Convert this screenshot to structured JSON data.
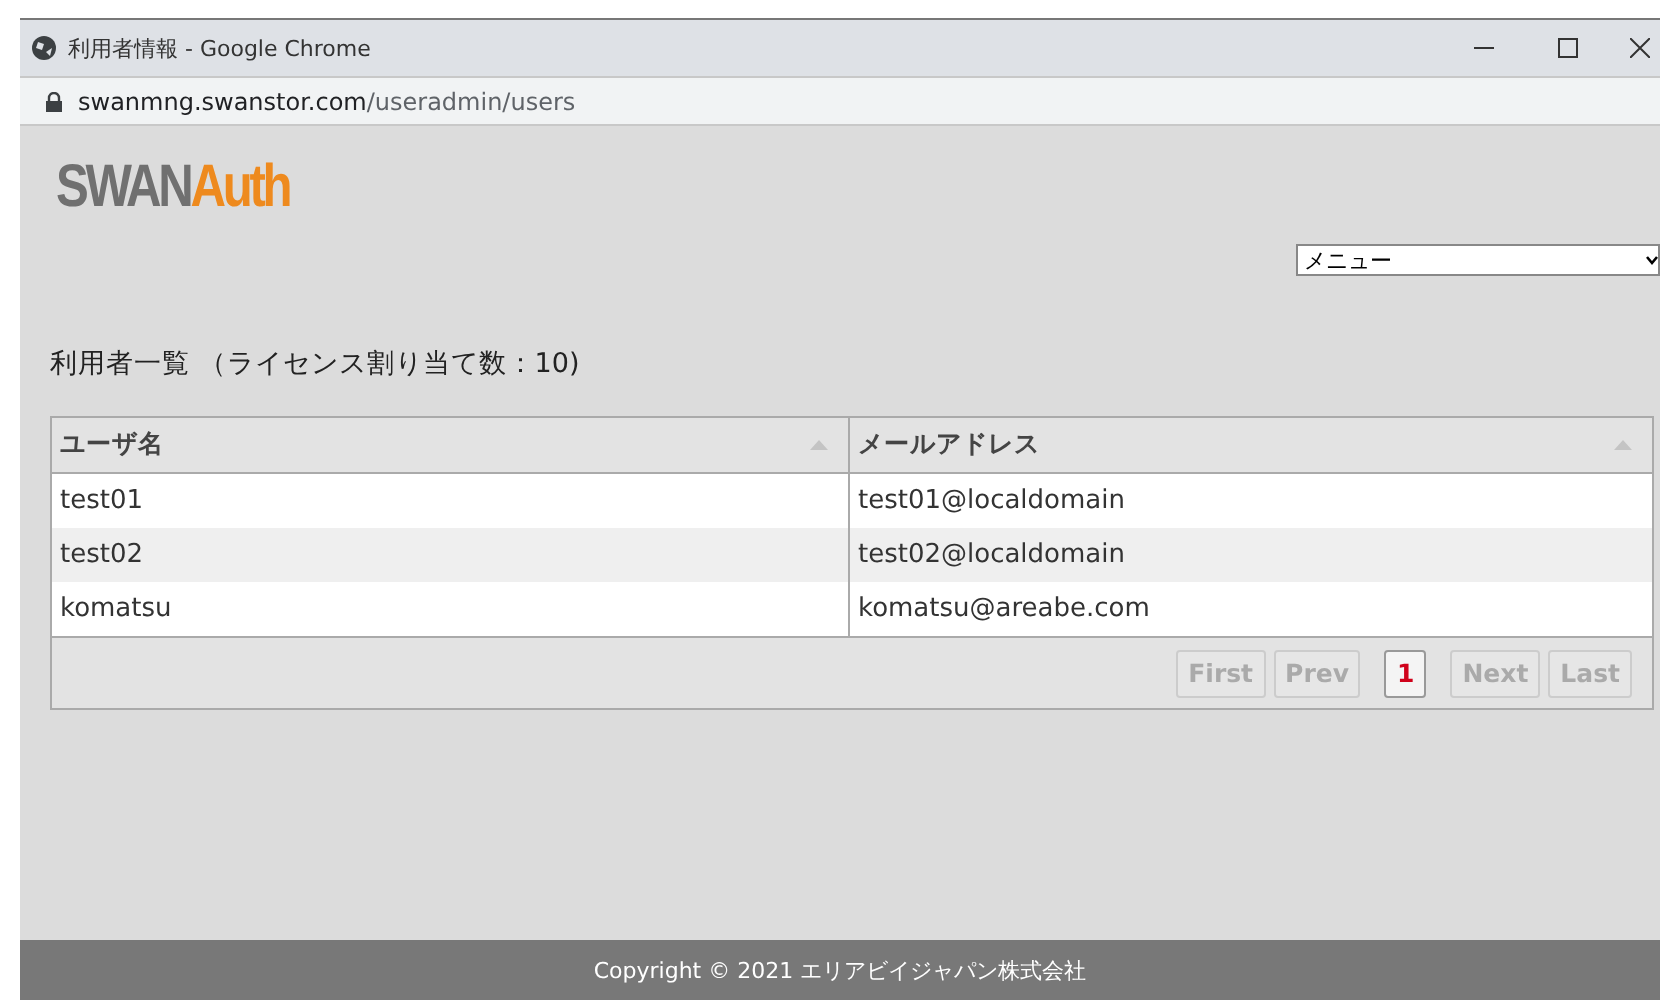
{
  "window": {
    "title": "利用者情報 - Google Chrome"
  },
  "address_bar": {
    "host": "swanmng.swanstor.com",
    "path": "/useradmin/users"
  },
  "logo": {
    "part_1": "SWAN",
    "part_2": "Auth"
  },
  "menu_select": {
    "value": "メニュー"
  },
  "heading": "利用者一覧 （ライセンス割り当て数：10)",
  "table": {
    "columns": [
      "ユーザ名",
      "メールアドレス"
    ],
    "rows": [
      [
        "test01",
        "test01@localdomain"
      ],
      [
        "test02",
        "test02@localdomain"
      ],
      [
        "komatsu",
        "komatsu@areabe.com"
      ]
    ]
  },
  "pager": [
    {
      "label": "First",
      "kind": "nav",
      "disabled": true,
      "selected": false
    },
    {
      "label": "Prev",
      "kind": "nav",
      "disabled": true,
      "selected": false
    },
    {
      "label": "1",
      "kind": "page",
      "disabled": false,
      "selected": true
    },
    {
      "label": "Next",
      "kind": "nav",
      "disabled": true,
      "selected": false
    },
    {
      "label": "Last",
      "kind": "nav",
      "disabled": true,
      "selected": false
    }
  ],
  "footer": "Copyright © 2021 エリアビイジャパン株式会社"
}
